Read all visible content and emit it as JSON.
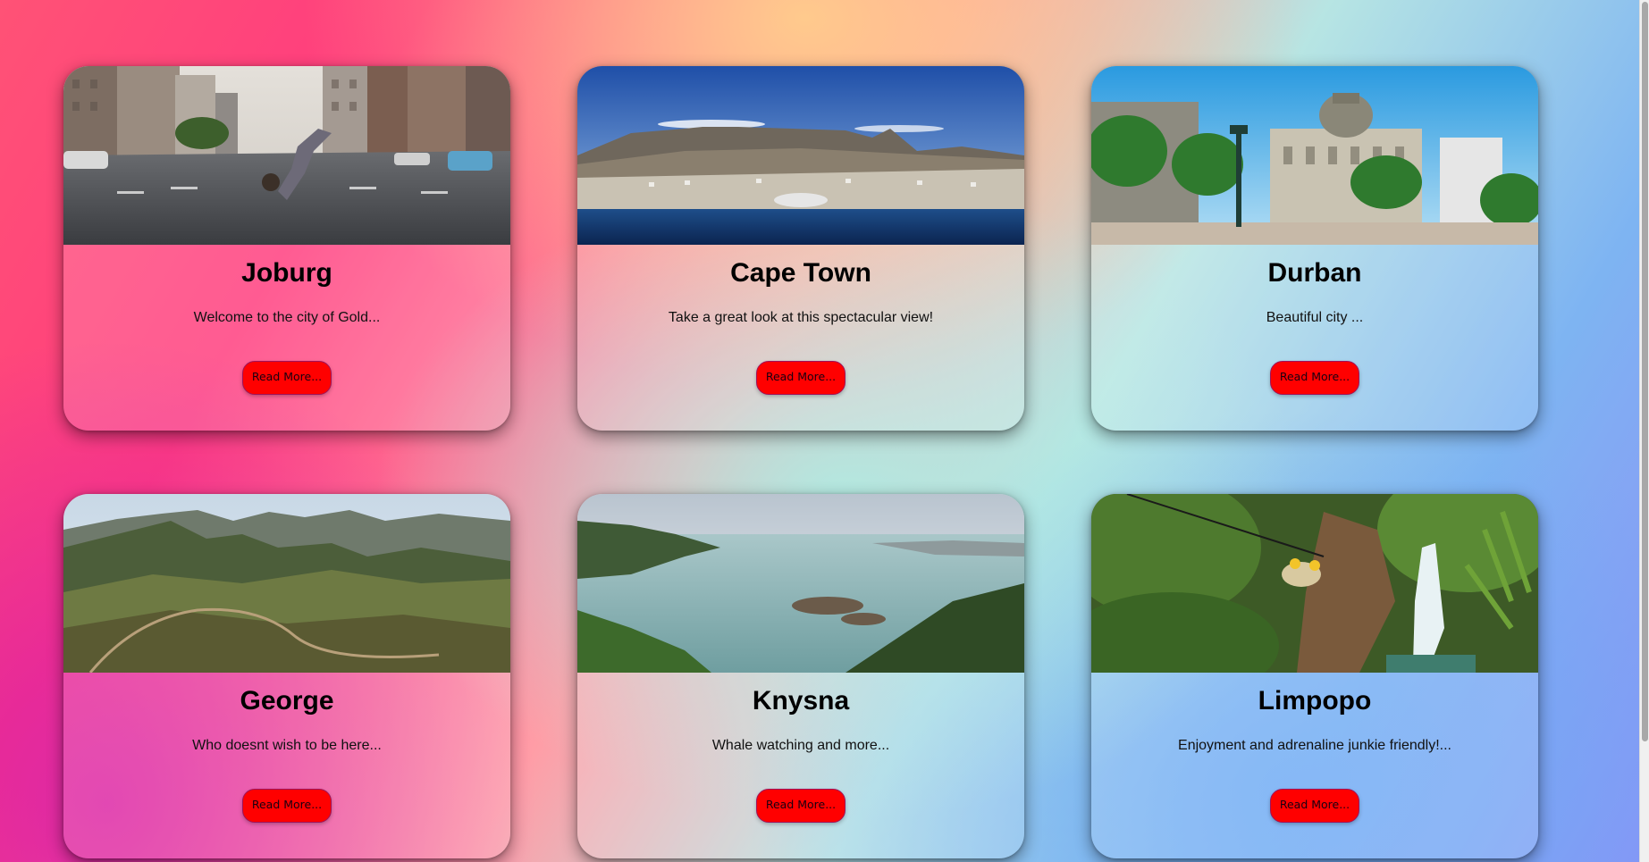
{
  "cards": [
    {
      "title": "Joburg",
      "text": "Welcome to the city of Gold...",
      "button": "Read More..."
    },
    {
      "title": "Cape Town",
      "text": "Take a great look at this spectacular view!",
      "button": "Read More..."
    },
    {
      "title": "Durban",
      "text": "Beautiful city ...",
      "button": "Read More..."
    },
    {
      "title": "George",
      "text": "Who doesnt wish to be here...",
      "button": "Read More..."
    },
    {
      "title": "Knysna",
      "text": "Whale watching and more...",
      "button": "Read More..."
    },
    {
      "title": "Limpopo",
      "text": "Enjoyment and adrenaline junkie friendly!...",
      "button": "Read More..."
    }
  ],
  "colors": {
    "button": "#ff0000"
  }
}
